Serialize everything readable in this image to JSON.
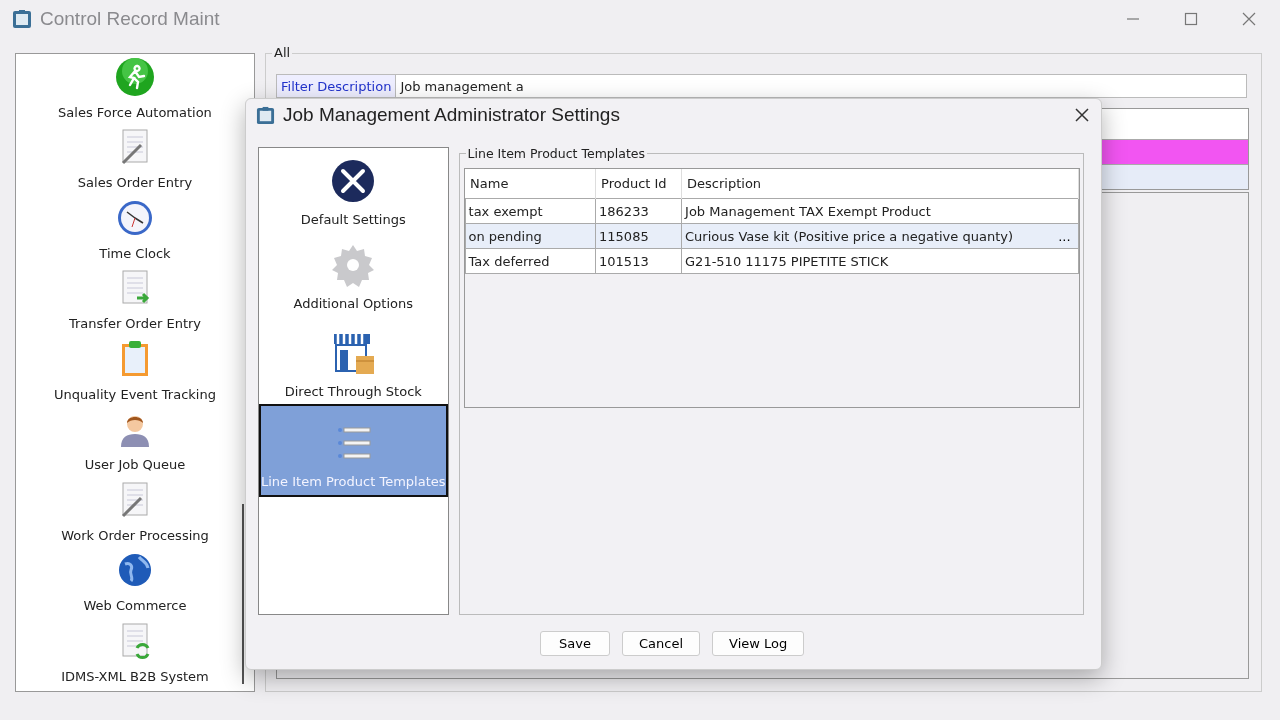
{
  "window": {
    "title": "Control Record Maint"
  },
  "sidebar": {
    "items": [
      {
        "label": "Sales Force Automation",
        "kind": "runner"
      },
      {
        "label": "Sales Order Entry",
        "kind": "pen"
      },
      {
        "label": "Time Clock",
        "kind": "clock"
      },
      {
        "label": "Transfer Order Entry",
        "kind": "transfer"
      },
      {
        "label": "Unquality Event Tracking",
        "kind": "clipboard"
      },
      {
        "label": "User Job Queue",
        "kind": "user"
      },
      {
        "label": "Work Order Processing",
        "kind": "pen"
      },
      {
        "label": "Web Commerce",
        "kind": "globe"
      },
      {
        "label": "IDMS-XML B2B System",
        "kind": "sync"
      }
    ]
  },
  "group": {
    "title": "All",
    "filter": {
      "label": "Filter Description",
      "value": "Job management a"
    },
    "list_rows": [
      {
        "color": "#f255f2"
      },
      {
        "color": "#e6ecf8"
      }
    ]
  },
  "dialog": {
    "title": "Job Management Administrator Settings",
    "nav": [
      {
        "label": "Default Settings",
        "kind": "tools",
        "selected": false
      },
      {
        "label": "Additional Options",
        "kind": "gear",
        "selected": false
      },
      {
        "label": "Direct Through Stock",
        "kind": "store",
        "selected": false
      },
      {
        "label": "Line Item Product Templates",
        "kind": "list",
        "selected": true
      }
    ],
    "section_title": "Line Item Product Templates",
    "table": {
      "columns": [
        "Name",
        "Product Id",
        "Description"
      ],
      "rows": [
        {
          "cells": [
            "tax exempt",
            "186233",
            "Job Management TAX Exempt Product"
          ],
          "selected": false
        },
        {
          "cells": [
            "on pending",
            "115085",
            "Curious Vase kit (Positive price a negative quanty)"
          ],
          "selected": true,
          "button": "..."
        },
        {
          "cells": [
            "Tax deferred",
            "101513",
            "G21-510 11175 PIPETITE STICK"
          ],
          "selected": false
        }
      ]
    },
    "buttons": [
      "Save",
      "Cancel",
      "View Log"
    ]
  }
}
